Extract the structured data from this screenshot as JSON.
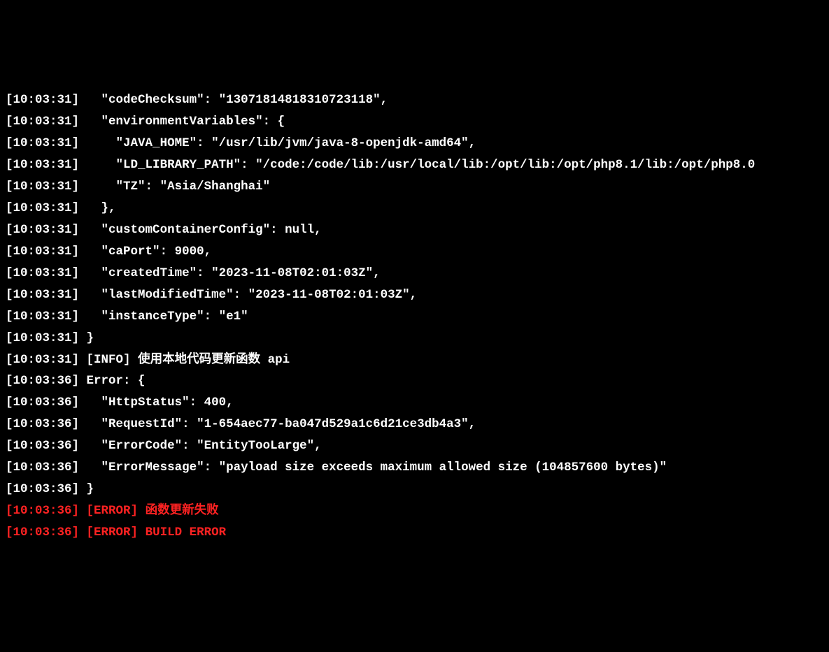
{
  "lines": [
    {
      "ts": "[10:03:31]",
      "type": "plain",
      "text": "  \"codeChecksum\": \"13071814818310723118\","
    },
    {
      "ts": "[10:03:31]",
      "type": "plain",
      "text": "  \"environmentVariables\": {"
    },
    {
      "ts": "[10:03:31]",
      "type": "plain",
      "text": "    \"JAVA_HOME\": \"/usr/lib/jvm/java-8-openjdk-amd64\","
    },
    {
      "ts": "[10:03:31]",
      "type": "plain",
      "text": "    \"LD_LIBRARY_PATH\": \"/code:/code/lib:/usr/local/lib:/opt/lib:/opt/php8.1/lib:/opt/php8.0"
    },
    {
      "ts": "[10:03:31]",
      "type": "plain",
      "text": "    \"TZ\": \"Asia/Shanghai\""
    },
    {
      "ts": "[10:03:31]",
      "type": "plain",
      "text": "  },"
    },
    {
      "ts": "[10:03:31]",
      "type": "plain",
      "text": "  \"customContainerConfig\": null,"
    },
    {
      "ts": "[10:03:31]",
      "type": "plain",
      "text": "  \"caPort\": 9000,"
    },
    {
      "ts": "[10:03:31]",
      "type": "plain",
      "text": "  \"createdTime\": \"2023-11-08T02:01:03Z\","
    },
    {
      "ts": "[10:03:31]",
      "type": "plain",
      "text": "  \"lastModifiedTime\": \"2023-11-08T02:01:03Z\","
    },
    {
      "ts": "[10:03:31]",
      "type": "plain",
      "text": "  \"instanceType\": \"e1\""
    },
    {
      "ts": "[10:03:31]",
      "type": "plain",
      "text": "}"
    },
    {
      "ts": "[10:03:31]",
      "type": "info",
      "tag": "[INFO]",
      "text": "使用本地代码更新函数 api"
    },
    {
      "ts": "[10:03:36]",
      "type": "plain",
      "text": "Error: {"
    },
    {
      "ts": "[10:03:36]",
      "type": "plain",
      "text": "  \"HttpStatus\": 400,"
    },
    {
      "ts": "[10:03:36]",
      "type": "plain",
      "text": "  \"RequestId\": \"1-654aec77-ba047d529a1c6d21ce3db4a3\","
    },
    {
      "ts": "[10:03:36]",
      "type": "plain",
      "text": "  \"ErrorCode\": \"EntityTooLarge\","
    },
    {
      "ts": "[10:03:36]",
      "type": "plain",
      "text": "  \"ErrorMessage\": \"payload size exceeds maximum allowed size (104857600 bytes)\""
    },
    {
      "ts": "[10:03:36]",
      "type": "plain",
      "text": "}"
    },
    {
      "ts": "[10:03:36]",
      "type": "error",
      "tag": "[ERROR]",
      "text": "函数更新失败"
    },
    {
      "ts": "[10:03:36]",
      "type": "error",
      "tag": "[ERROR]",
      "text": "BUILD ERROR"
    }
  ]
}
